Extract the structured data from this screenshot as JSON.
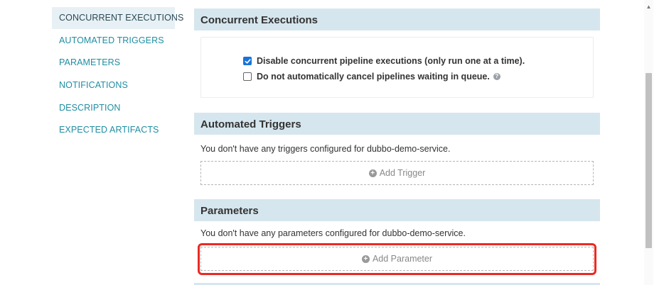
{
  "nav": {
    "items": [
      {
        "label": "CONCURRENT EXECUTIONS",
        "active": true
      },
      {
        "label": "AUTOMATED TRIGGERS",
        "active": false
      },
      {
        "label": "PARAMETERS",
        "active": false
      },
      {
        "label": "NOTIFICATIONS",
        "active": false
      },
      {
        "label": "DESCRIPTION",
        "active": false
      },
      {
        "label": "EXPECTED ARTIFACTS",
        "active": false
      }
    ]
  },
  "concurrent": {
    "title": "Concurrent Executions",
    "disable_concurrent_label": "Disable concurrent pipeline executions (only run one at a time).",
    "disable_concurrent_checked": true,
    "no_cancel_label": "Do not automatically cancel pipelines waiting in queue.",
    "no_cancel_checked": false,
    "help_icon": "?"
  },
  "triggers": {
    "title": "Automated Triggers",
    "empty_text": "You don't have any triggers configured for dubbo-demo-service.",
    "add_label": "Add Trigger"
  },
  "parameters": {
    "title": "Parameters",
    "empty_text": "You don't have any parameters configured for dubbo-demo-service.",
    "add_label": "Add Parameter"
  },
  "icons": {
    "plus": "+",
    "check": "✓",
    "scroll_up": "▲"
  },
  "colors": {
    "accent_link": "#1f8ea3",
    "header_bg": "#d6e6ee",
    "checkbox_blue": "#1a73d9",
    "highlight_red": "#ea2a24"
  }
}
